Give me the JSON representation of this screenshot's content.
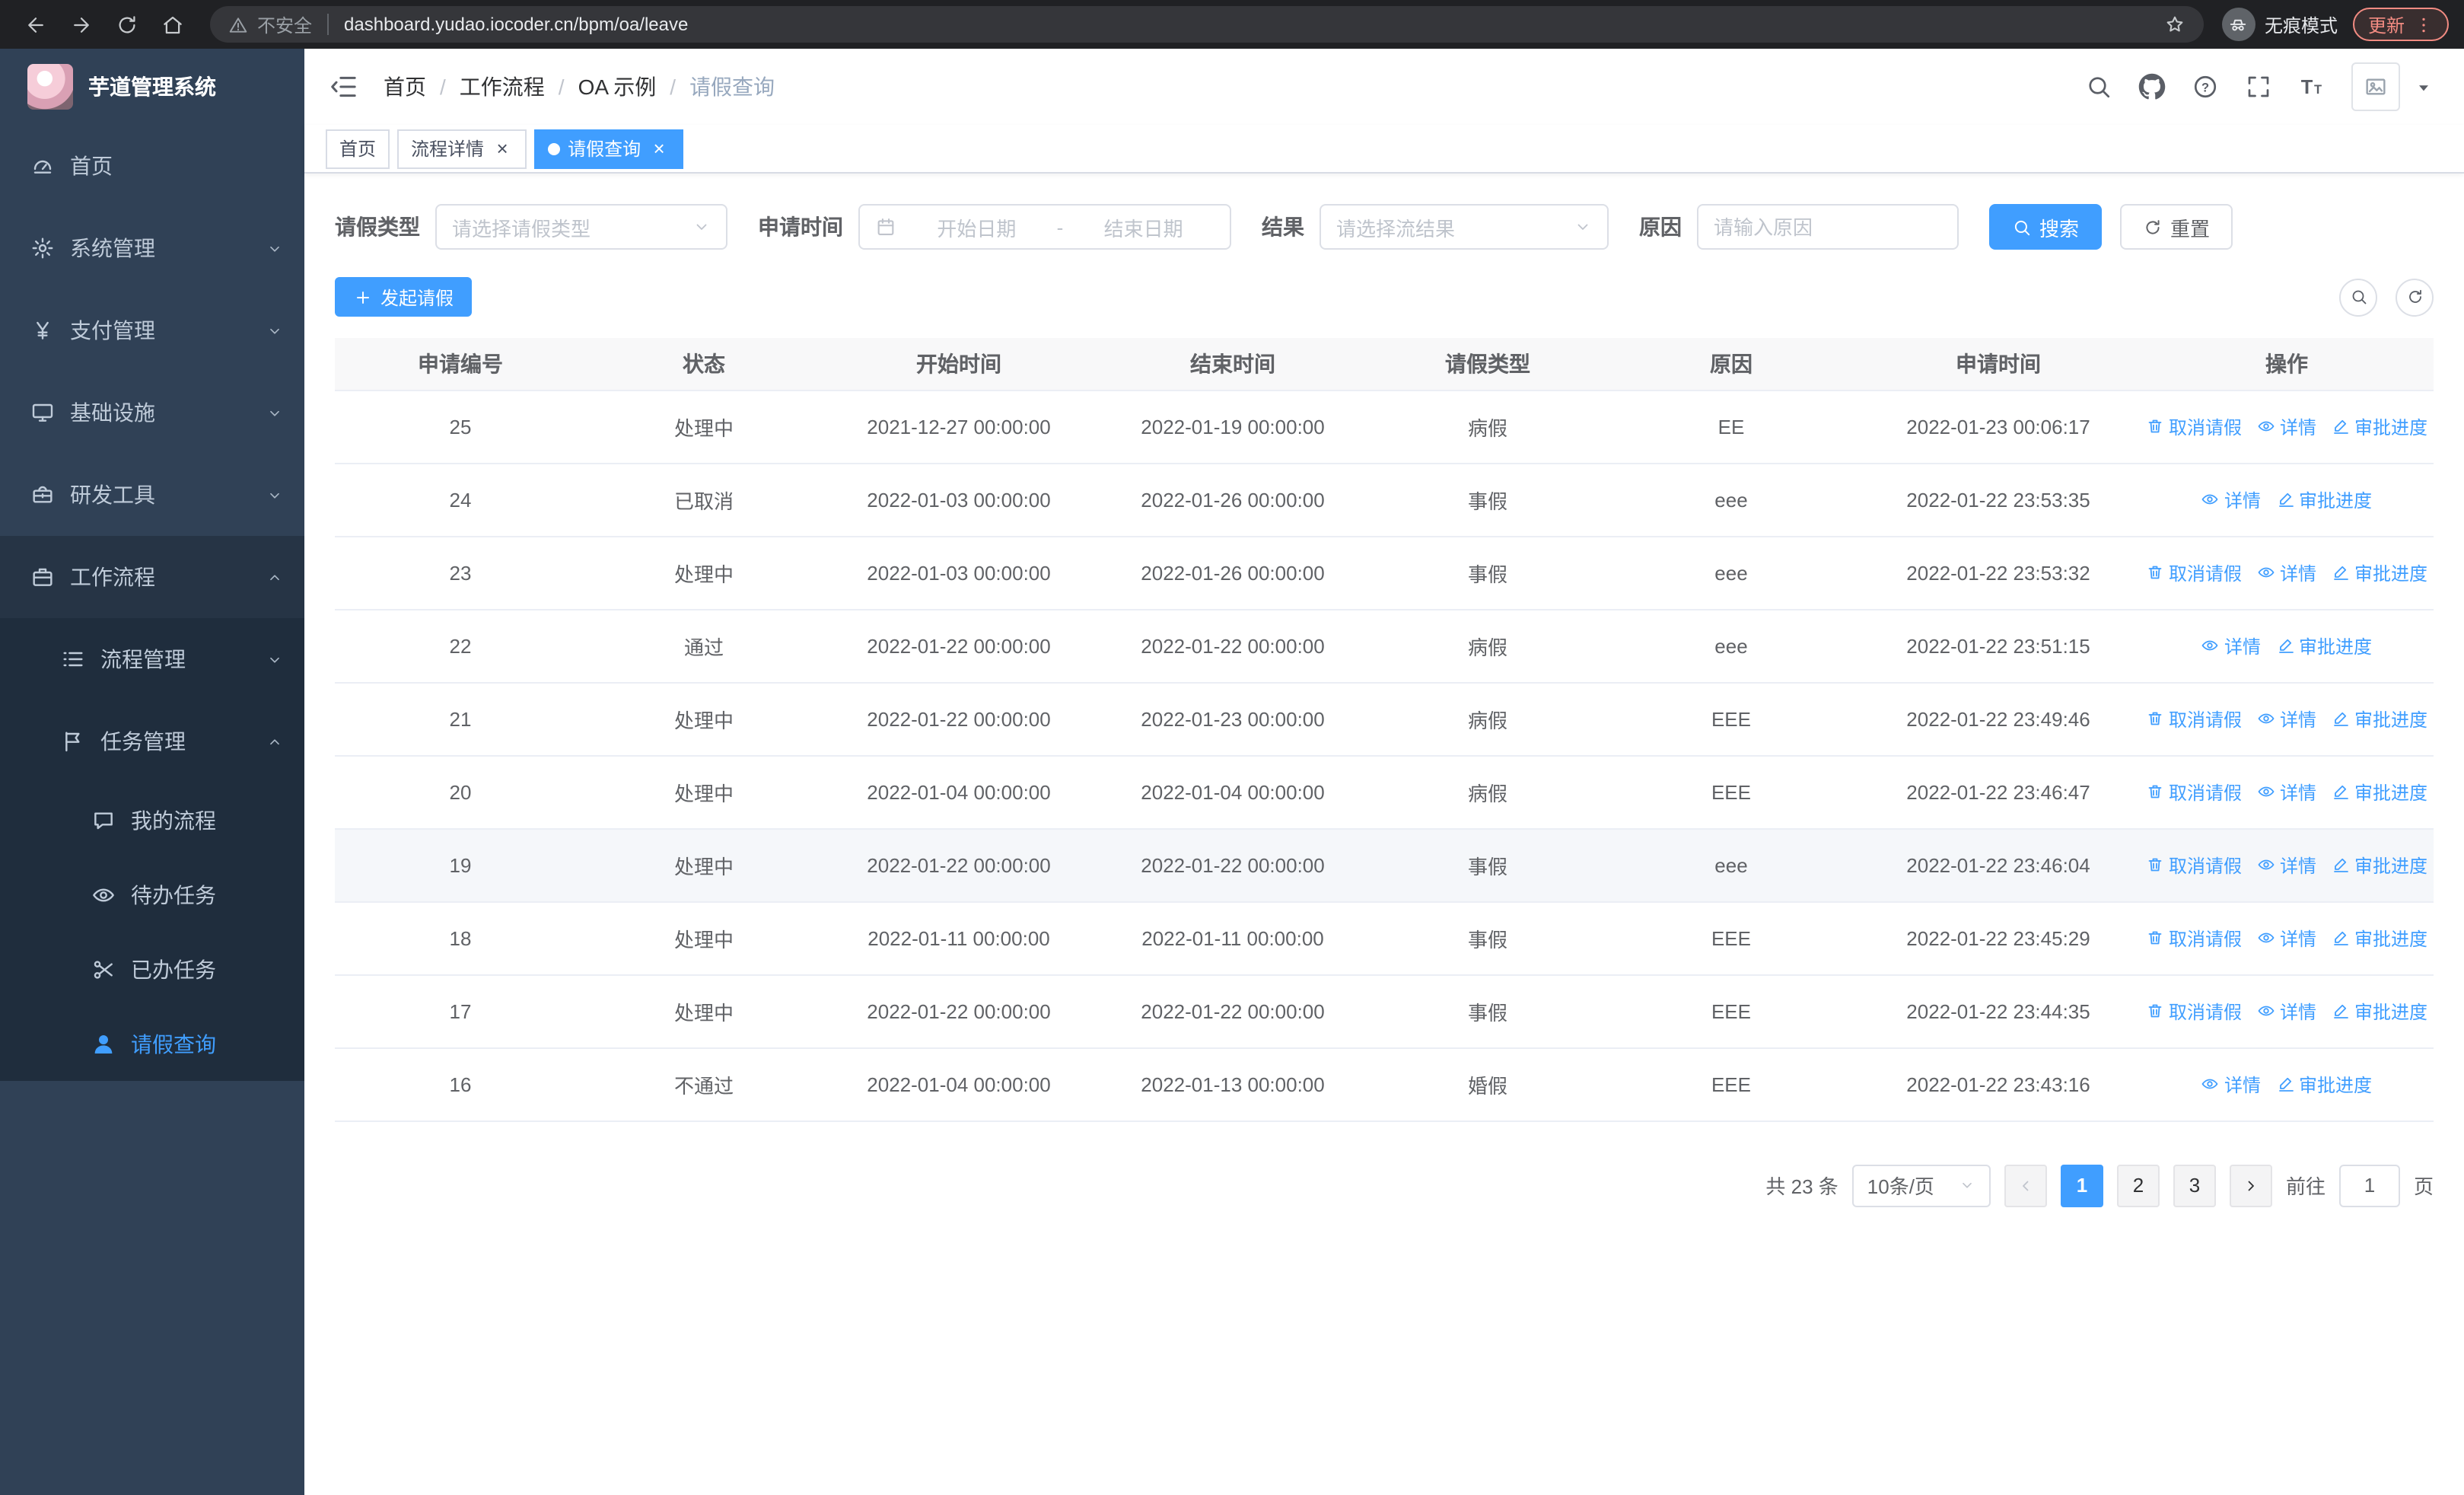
{
  "browser": {
    "security_label": "不安全",
    "url": "dashboard.yudao.iocoder.cn/bpm/oa/leave",
    "incognito_label": "无痕模式",
    "update_label": "更新"
  },
  "sidebar": {
    "logo_title": "芋道管理系统",
    "items": [
      {
        "key": "home",
        "label": "首页",
        "icon": "dashboard-icon",
        "level": 1
      },
      {
        "key": "system",
        "label": "系统管理",
        "icon": "gear-icon",
        "level": 1,
        "chevron": "down"
      },
      {
        "key": "payment",
        "label": "支付管理",
        "icon": "yen-icon",
        "level": 1,
        "chevron": "down"
      },
      {
        "key": "infra",
        "label": "基础设施",
        "icon": "monitor-icon",
        "level": 1,
        "chevron": "down"
      },
      {
        "key": "devtools",
        "label": "研发工具",
        "icon": "toolbox-icon",
        "level": 1,
        "chevron": "down"
      },
      {
        "key": "workflow",
        "label": "工作流程",
        "icon": "briefcase-icon",
        "level": 1,
        "chevron": "up",
        "open": true
      },
      {
        "key": "process-mgmt",
        "label": "流程管理",
        "icon": "list-icon",
        "level": 2,
        "chevron": "down"
      },
      {
        "key": "task-mgmt",
        "label": "任务管理",
        "icon": "flag-icon",
        "level": 2,
        "chevron": "up",
        "open": true
      },
      {
        "key": "my-process",
        "label": "我的流程",
        "icon": "chat-icon",
        "level": 3
      },
      {
        "key": "todo-tasks",
        "label": "待办任务",
        "icon": "eye-icon",
        "level": 3
      },
      {
        "key": "done-tasks",
        "label": "已办任务",
        "icon": "scissors-icon",
        "level": 3
      },
      {
        "key": "leave-query",
        "label": "请假查询",
        "icon": "user-icon",
        "level": 3,
        "active": true
      }
    ]
  },
  "header": {
    "breadcrumb": [
      "首页",
      "工作流程",
      "OA 示例",
      "请假查询"
    ]
  },
  "tabs": [
    {
      "key": "home",
      "label": "首页",
      "closable": false,
      "active": false
    },
    {
      "key": "detail",
      "label": "流程详情",
      "closable": true,
      "active": false
    },
    {
      "key": "leave-query",
      "label": "请假查询",
      "closable": true,
      "active": true
    }
  ],
  "filters": {
    "leave_type": {
      "label": "请假类型",
      "placeholder": "请选择请假类型"
    },
    "apply_time": {
      "label": "申请时间",
      "start_placeholder": "开始日期",
      "separator": "-",
      "end_placeholder": "结束日期"
    },
    "result": {
      "label": "结果",
      "placeholder": "请选择流结果"
    },
    "reason": {
      "label": "原因",
      "placeholder": "请输入原因"
    },
    "search_label": "搜索",
    "reset_label": "重置"
  },
  "toolbar": {
    "create_label": "发起请假"
  },
  "table": {
    "columns": [
      "申请编号",
      "状态",
      "开始时间",
      "结束时间",
      "请假类型",
      "原因",
      "申请时间",
      "操作"
    ],
    "action_labels": {
      "cancel": "取消请假",
      "detail": "详情",
      "progress": "审批进度"
    },
    "rows": [
      {
        "id": "25",
        "status": "处理中",
        "start": "2021-12-27 00:00:00",
        "end": "2022-01-19 00:00:00",
        "type": "病假",
        "reason": "EE",
        "applied": "2022-01-23 00:06:17",
        "actions": [
          "cancel",
          "detail",
          "progress"
        ]
      },
      {
        "id": "24",
        "status": "已取消",
        "start": "2022-01-03 00:00:00",
        "end": "2022-01-26 00:00:00",
        "type": "事假",
        "reason": "eee",
        "applied": "2022-01-22 23:53:35",
        "actions": [
          "detail",
          "progress"
        ]
      },
      {
        "id": "23",
        "status": "处理中",
        "start": "2022-01-03 00:00:00",
        "end": "2022-01-26 00:00:00",
        "type": "事假",
        "reason": "eee",
        "applied": "2022-01-22 23:53:32",
        "actions": [
          "cancel",
          "detail",
          "progress"
        ]
      },
      {
        "id": "22",
        "status": "通过",
        "start": "2022-01-22 00:00:00",
        "end": "2022-01-22 00:00:00",
        "type": "病假",
        "reason": "eee",
        "applied": "2022-01-22 23:51:15",
        "actions": [
          "detail",
          "progress"
        ]
      },
      {
        "id": "21",
        "status": "处理中",
        "start": "2022-01-22 00:00:00",
        "end": "2022-01-23 00:00:00",
        "type": "病假",
        "reason": "EEE",
        "applied": "2022-01-22 23:49:46",
        "actions": [
          "cancel",
          "detail",
          "progress"
        ]
      },
      {
        "id": "20",
        "status": "处理中",
        "start": "2022-01-04 00:00:00",
        "end": "2022-01-04 00:00:00",
        "type": "病假",
        "reason": "EEE",
        "applied": "2022-01-22 23:46:47",
        "actions": [
          "cancel",
          "detail",
          "progress"
        ]
      },
      {
        "id": "19",
        "status": "处理中",
        "start": "2022-01-22 00:00:00",
        "end": "2022-01-22 00:00:00",
        "type": "事假",
        "reason": "eee",
        "applied": "2022-01-22 23:46:04",
        "actions": [
          "cancel",
          "detail",
          "progress"
        ],
        "hover": true
      },
      {
        "id": "18",
        "status": "处理中",
        "start": "2022-01-11 00:00:00",
        "end": "2022-01-11 00:00:00",
        "type": "事假",
        "reason": "EEE",
        "applied": "2022-01-22 23:45:29",
        "actions": [
          "cancel",
          "detail",
          "progress"
        ]
      },
      {
        "id": "17",
        "status": "处理中",
        "start": "2022-01-22 00:00:00",
        "end": "2022-01-22 00:00:00",
        "type": "事假",
        "reason": "EEE",
        "applied": "2022-01-22 23:44:35",
        "actions": [
          "cancel",
          "detail",
          "progress"
        ]
      },
      {
        "id": "16",
        "status": "不通过",
        "start": "2022-01-04 00:00:00",
        "end": "2022-01-13 00:00:00",
        "type": "婚假",
        "reason": "EEE",
        "applied": "2022-01-22 23:43:16",
        "actions": [
          "detail",
          "progress"
        ]
      }
    ]
  },
  "pagination": {
    "total_label": "共 23 条",
    "page_size": "10条/页",
    "pages": [
      "1",
      "2",
      "3"
    ],
    "active_page": "1",
    "goto_prefix": "前往",
    "goto_value": "1",
    "goto_suffix": "页"
  },
  "colors": {
    "accent": "#409eff",
    "sidebar_bg": "#304156",
    "submenu_bg": "#1f2d3d"
  }
}
